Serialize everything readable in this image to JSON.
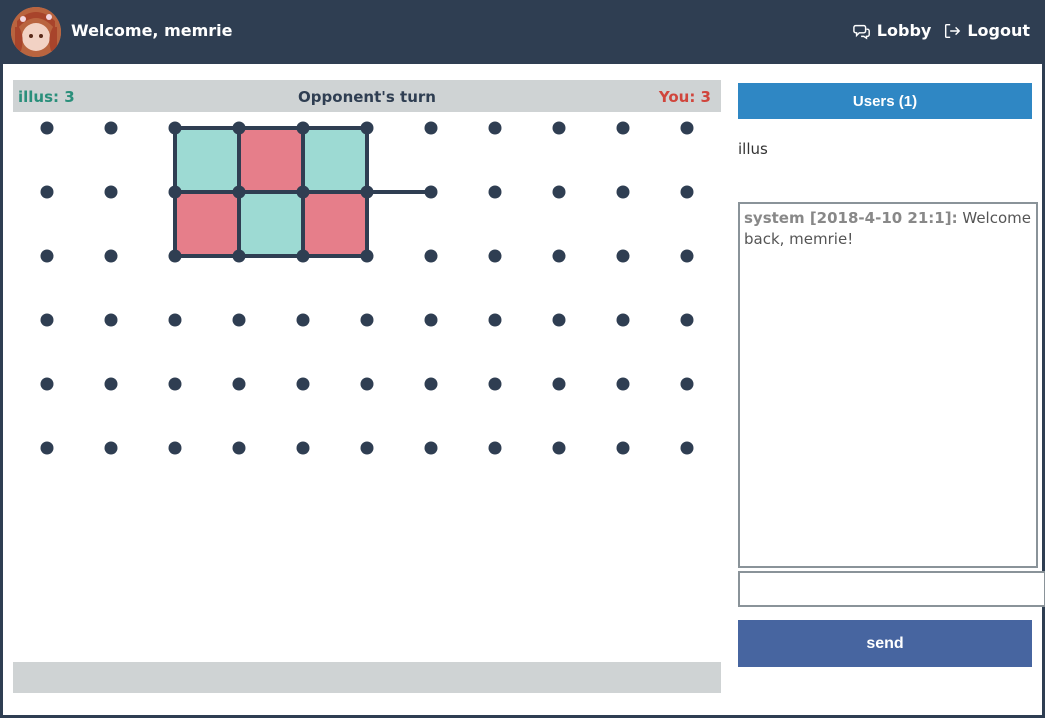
{
  "header": {
    "welcome": "Welcome, memrie",
    "lobby_label": "Lobby",
    "logout_label": "Logout"
  },
  "game": {
    "opponent_score": "illus: 3",
    "status": "Opponent's turn",
    "player_score": "You: 3",
    "grid": {
      "cols": 11,
      "rows": 6
    },
    "boxes": [
      {
        "col": 2,
        "row": 0,
        "owner": "opponent"
      },
      {
        "col": 3,
        "row": 0,
        "owner": "player"
      },
      {
        "col": 4,
        "row": 0,
        "owner": "opponent"
      },
      {
        "col": 2,
        "row": 1,
        "owner": "player"
      },
      {
        "col": 3,
        "row": 1,
        "owner": "opponent"
      },
      {
        "col": 4,
        "row": 1,
        "owner": "player"
      }
    ],
    "extra_lines": [
      {
        "from": [
          5,
          1
        ],
        "to": [
          6,
          1
        ]
      }
    ],
    "colors": {
      "opponent": "#9ddad3",
      "player": "#e67e8a",
      "line": "#2f3e52",
      "dot": "#2f3e52"
    }
  },
  "sidebar": {
    "users_button": "Users (1)",
    "users": [
      "illus"
    ],
    "chat": [
      {
        "author": "system [2018-4-10 21:1]:",
        "message": " Welcome back, memrie!"
      }
    ],
    "chat_input_value": "",
    "send_label": "send"
  }
}
